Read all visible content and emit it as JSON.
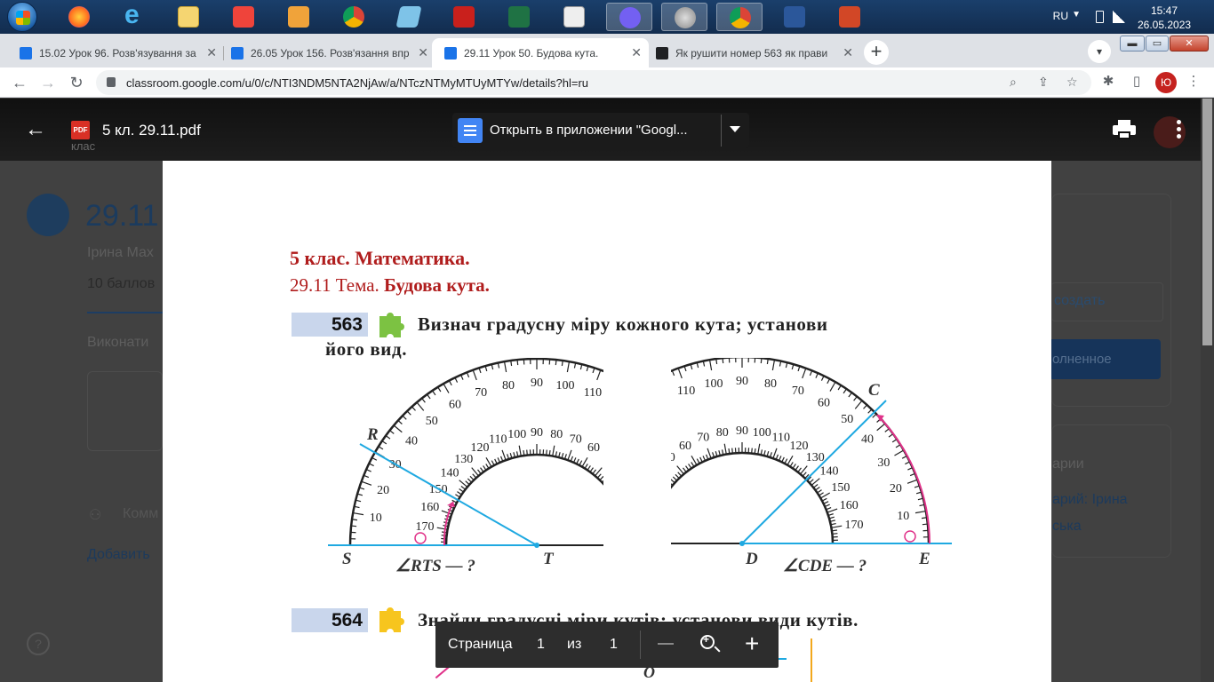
{
  "taskbar": {
    "icons": [
      "firefox-icon",
      "ie-icon",
      "explorer-icon",
      "anydesk-icon",
      "media-icon",
      "chrome-icon",
      "notebook-icon",
      "acrobat-icon",
      "excel-icon",
      "calculator-icon",
      "viber-icon",
      "speaker-icon",
      "chrome-profile-icon",
      "word-icon",
      "powerpoint-icon"
    ],
    "language": "RU",
    "time": "15:47",
    "date": "26.05.2023"
  },
  "tabs": [
    {
      "title": "15.02 Урок 96. Розв'язування за",
      "active": false
    },
    {
      "title": "26.05 Урок 156. Розв'язання впр",
      "active": false
    },
    {
      "title": "29.11 Урок 50. Будова кута.",
      "active": true
    },
    {
      "title": "Як рушити номер 563 як прави",
      "active": false
    }
  ],
  "address": {
    "url": "classroom.google.com/u/0/c/NTI3NDM5NTA2NjAw/a/NTczNTMyMTUyMTYw/details?hl=ru"
  },
  "profile": {
    "initial": "Ю"
  },
  "viewer": {
    "file_name": "5 кл. 29.11.pdf",
    "open_with": "Открыть в приложении \"Googl..."
  },
  "background": {
    "title": "29.11",
    "author": "Ірина Мах",
    "points": "10 баллов",
    "execute": "Виконати",
    "comments": "Комм",
    "add": "Добавить",
    "create": "создать",
    "done": "олненное",
    "right_comments": "арии",
    "right_comment_author": "арий: Ірина",
    "right_comment_author2": "ська",
    "crumb": "клас"
  },
  "pdf": {
    "heading_class": "5 клас.  Математика.",
    "heading_date": "29.11  Тема. ",
    "heading_topic": "Будова кута.",
    "task1_num": "563",
    "task1_line1": "Визнач  градусну  міру  кожного  кута;  установи",
    "task1_line2": "його вид.",
    "task2_num": "564",
    "task2_text": "Знайди градусні міри кутів; установи види кутів.",
    "fig_left_label": "∠RTS — ?",
    "fig_right_label": "∠CDE — ?",
    "points": {
      "S": "S",
      "T": "T",
      "R": "R",
      "D": "D",
      "E": "E",
      "C": "C",
      "O": "O"
    }
  },
  "pagebar": {
    "label": "Страница",
    "current": "1",
    "of": "из",
    "total": "1"
  }
}
